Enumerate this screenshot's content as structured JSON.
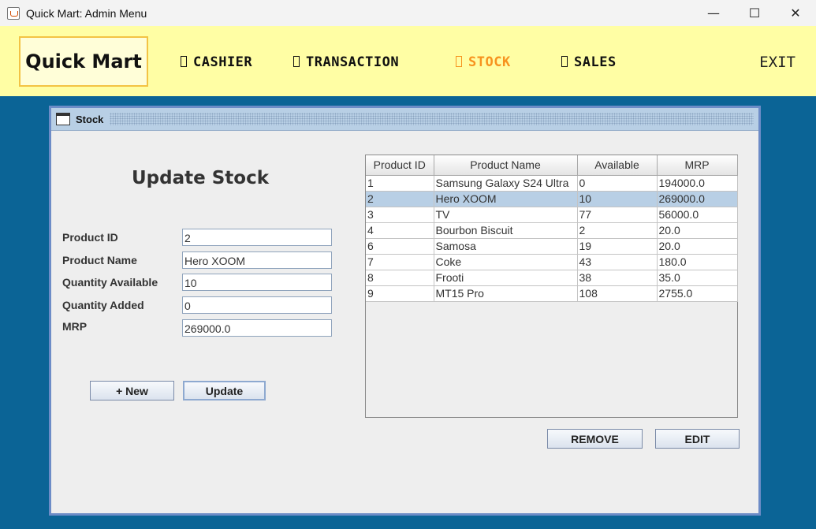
{
  "window": {
    "title": "Quick Mart: Admin Menu",
    "app_icon": "java-cup-icon",
    "minimize": "—",
    "maximize": "☐",
    "close": "✕"
  },
  "header": {
    "logo": "Quick Mart",
    "nav": [
      {
        "label": "CASHIER",
        "icon": "missing-glyph-icon"
      },
      {
        "label": "TRANSACTION",
        "icon": "missing-glyph-icon"
      },
      {
        "label": "STOCK",
        "icon": "missing-glyph-icon"
      },
      {
        "label": "SALES",
        "icon": "missing-glyph-icon"
      }
    ],
    "exit": "EXIT",
    "active_color": "#f7931e"
  },
  "frame": {
    "title": "Stock",
    "icon": "window-icon"
  },
  "form": {
    "heading": "Update Stock",
    "fields": [
      {
        "label": "Product ID",
        "value": "2"
      },
      {
        "label": "Product Name",
        "value": "Hero XOOM"
      },
      {
        "label": "Quantity Available",
        "value": "10"
      },
      {
        "label": "Quantity Added",
        "value": "0"
      },
      {
        "label": "MRP",
        "value": "269000.0"
      }
    ],
    "new_label": "+ New",
    "update_label": "Update"
  },
  "table": {
    "headers": [
      "Product ID",
      "Product Name",
      "Available",
      "MRP"
    ],
    "rows": [
      [
        "1",
        "Samsung Galaxy S24 Ultra",
        "0",
        "194000.0"
      ],
      [
        "2",
        "Hero XOOM",
        "10",
        "269000.0"
      ],
      [
        "3",
        "TV",
        "77",
        "56000.0"
      ],
      [
        "4",
        "Bourbon Biscuit",
        "2",
        "20.0"
      ],
      [
        "6",
        "Samosa",
        "19",
        "20.0"
      ],
      [
        "7",
        "Coke",
        "43",
        "180.0"
      ],
      [
        "8",
        "Frooti",
        "38",
        "35.0"
      ],
      [
        "9",
        "MT15 Pro",
        "108",
        "2755.0"
      ]
    ],
    "selected_row": 1
  },
  "actions": {
    "remove_label": "REMOVE",
    "edit_label": "EDIT"
  }
}
